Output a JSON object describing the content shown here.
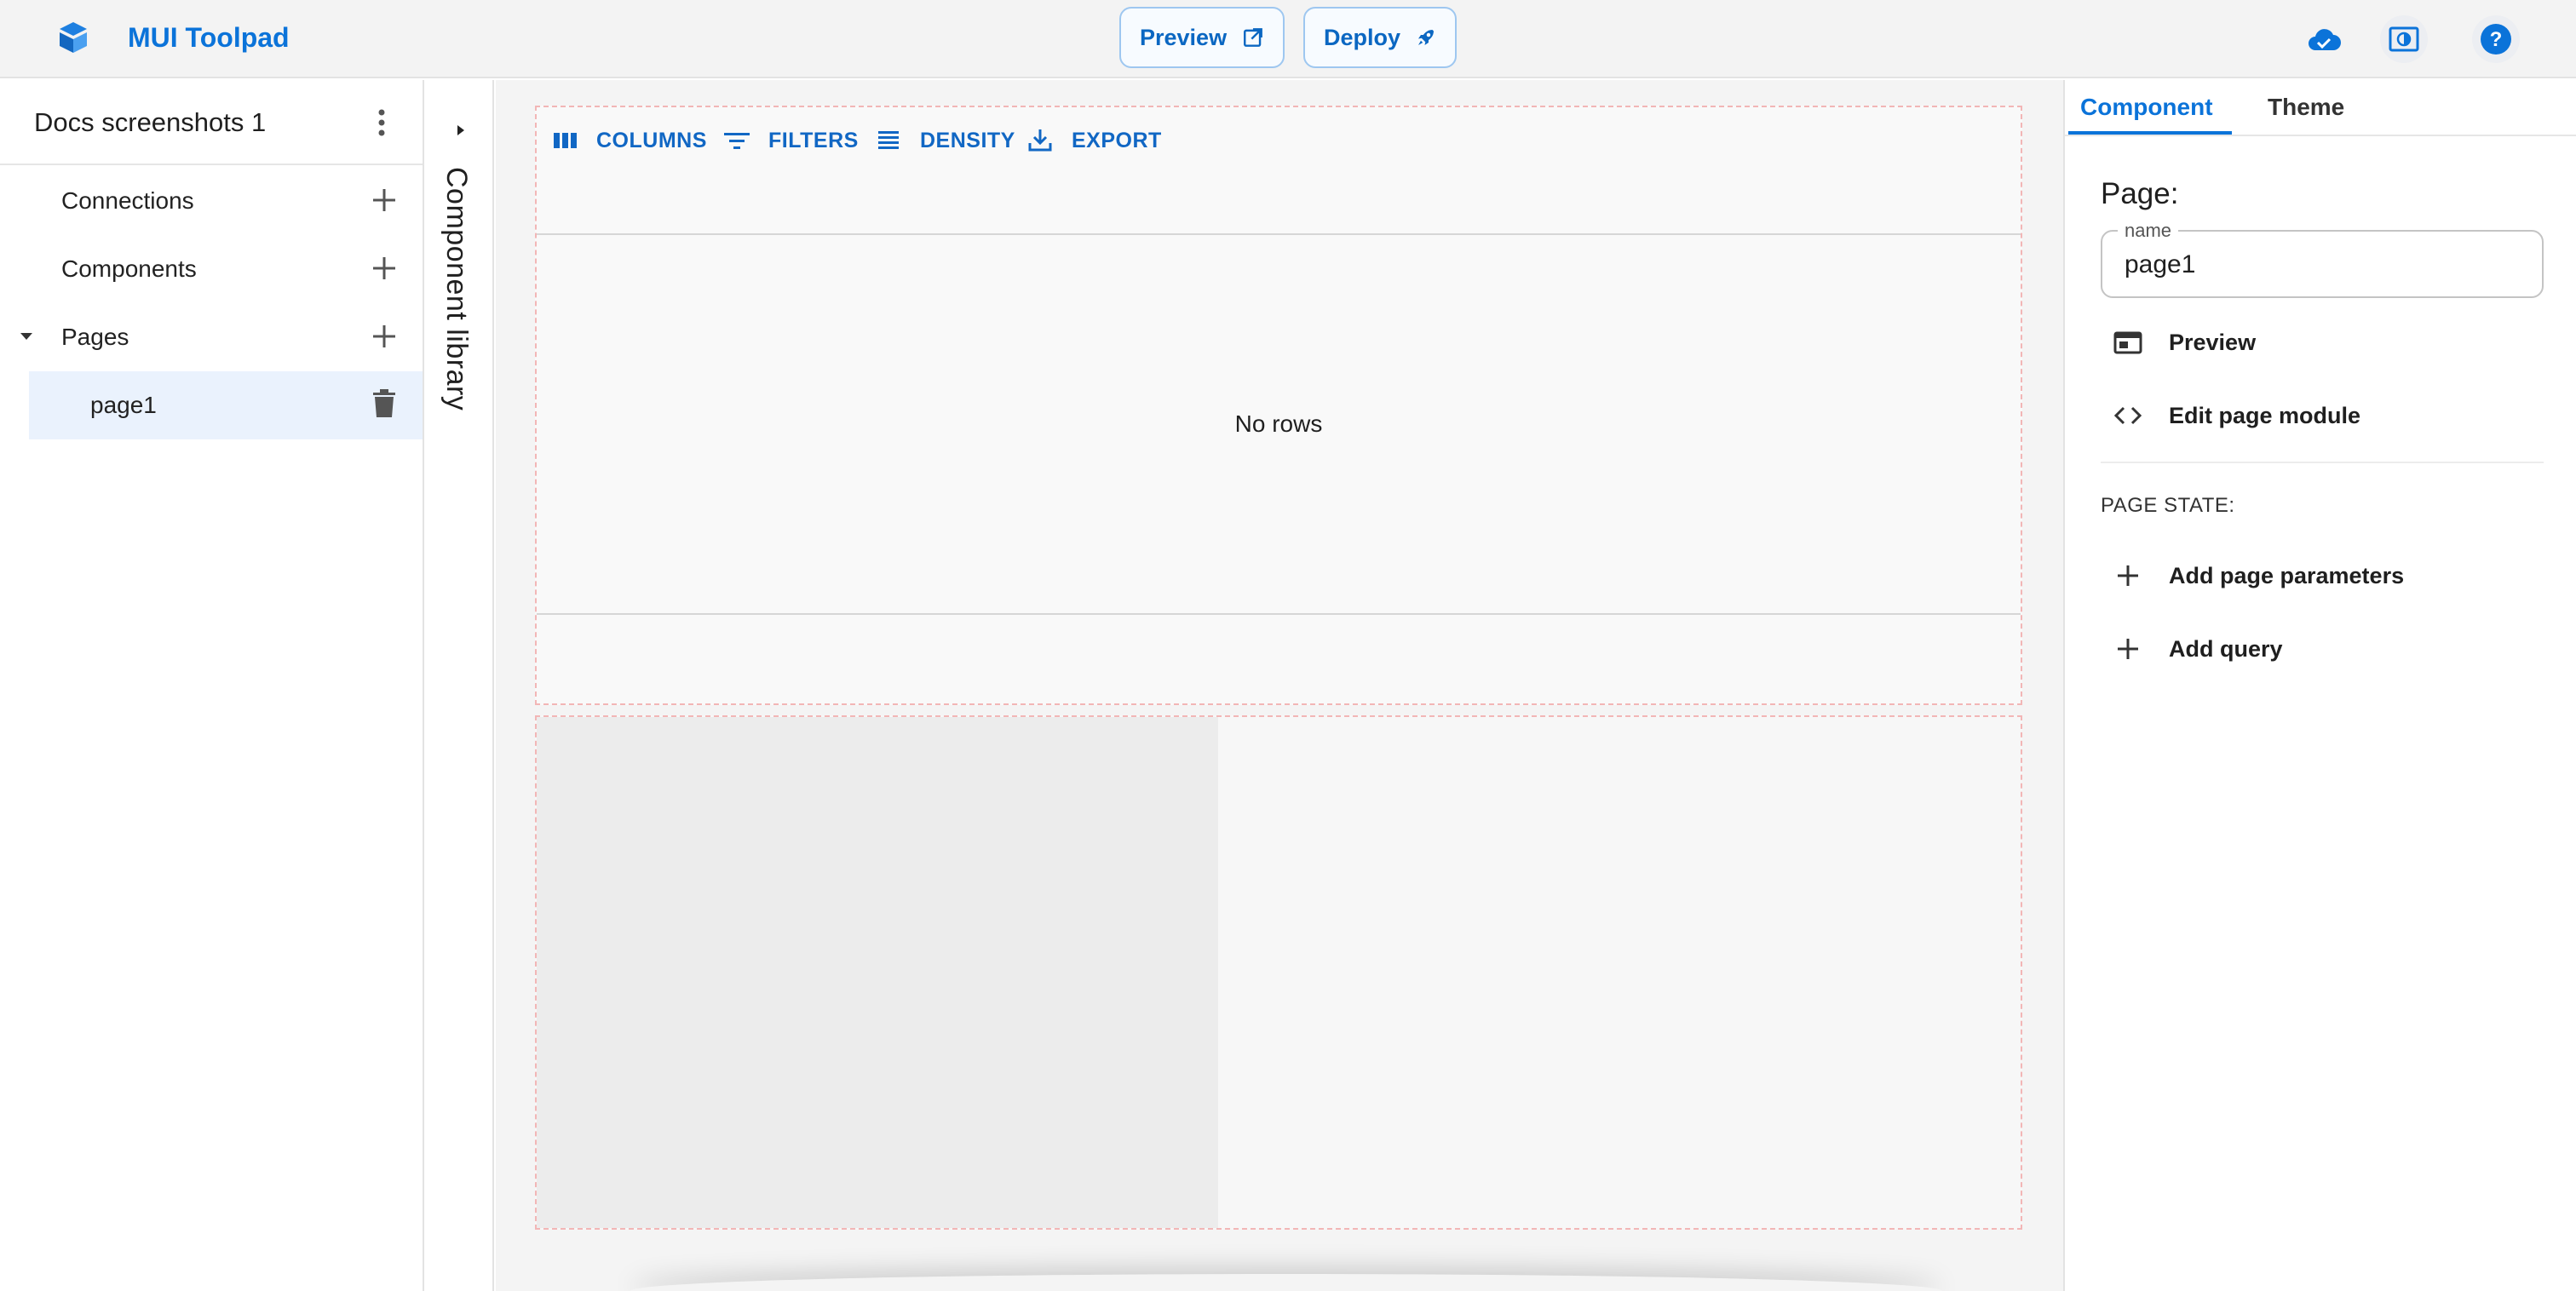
{
  "header": {
    "app_name": "MUI Toolpad",
    "preview_label": "Preview",
    "deploy_label": "Deploy",
    "icons": [
      "toolpad-logo-icon",
      "open-external-icon",
      "rocket-icon",
      "cloud-done-icon",
      "theme-toggle-icon",
      "help-icon"
    ]
  },
  "sidebar": {
    "project_title": "Docs screenshots 1",
    "items": [
      {
        "label": "Connections"
      },
      {
        "label": "Components"
      },
      {
        "label": "Pages"
      }
    ],
    "pages": [
      {
        "label": "page1"
      }
    ]
  },
  "component_library": {
    "label": "Component library"
  },
  "canvas": {
    "grid_toolbar": {
      "columns": "COLUMNS",
      "filters": "FILTERS",
      "density": "DENSITY",
      "export": "EXPORT"
    },
    "empty_text": "No rows"
  },
  "right_panel": {
    "tabs": [
      {
        "label": "Component",
        "active": true
      },
      {
        "label": "Theme",
        "active": false
      }
    ],
    "section_title": "Page:",
    "name_field": {
      "label": "name",
      "value": "page1"
    },
    "actions": {
      "preview": "Preview",
      "edit_module": "Edit page module"
    },
    "page_state_label": "PAGE STATE:",
    "add_params": "Add page parameters",
    "add_query": "Add query"
  },
  "colors": {
    "accent": "#0b73d9",
    "selected_bg": "#eaf2fd",
    "canvas_bg": "#f4f4f4",
    "dashed_outline": "#f2b6b6"
  }
}
